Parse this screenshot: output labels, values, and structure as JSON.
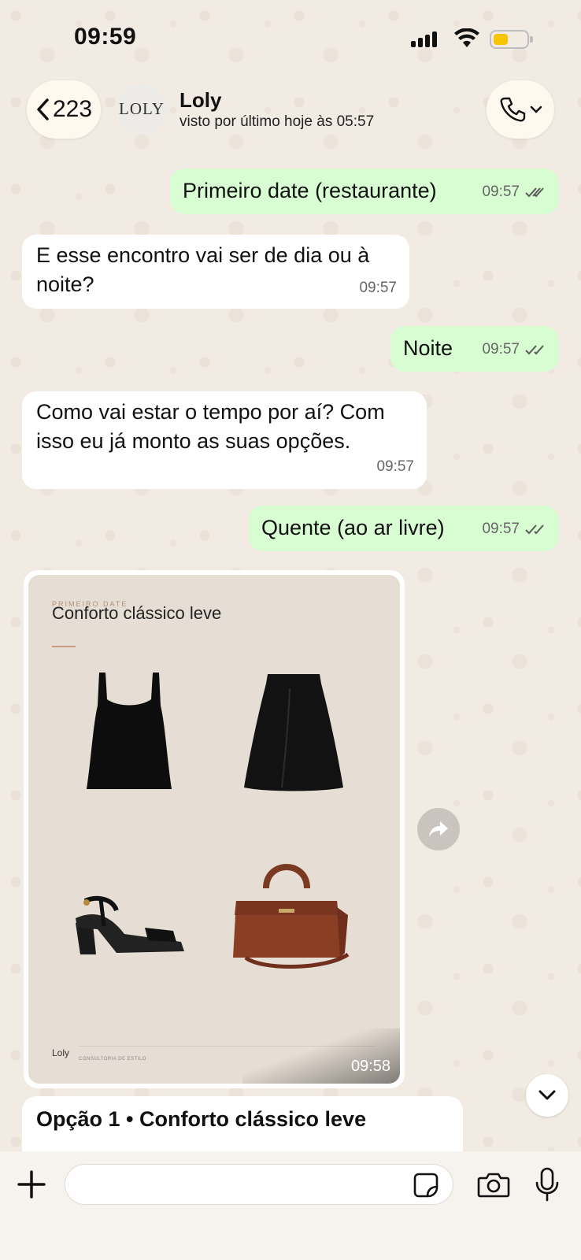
{
  "status_bar": {
    "time": "09:59"
  },
  "header": {
    "back_count": "223",
    "avatar_text": "LOLY",
    "contact_name": "Loly",
    "last_seen": "visto por último hoje às 05:57"
  },
  "messages": [
    {
      "direction": "out",
      "text": "Primeiro date (restaurante)",
      "time": "09:57",
      "status": "read"
    },
    {
      "direction": "in",
      "text": "E esse encontro vai ser de dia ou à noite?",
      "time": "09:57"
    },
    {
      "direction": "out",
      "text": "Noite",
      "time": "09:57",
      "status": "read"
    },
    {
      "direction": "in",
      "text": "Como vai estar o tempo por aí? Com isso eu já monto as suas opções.",
      "time": "09:57"
    },
    {
      "direction": "out",
      "text": "Quente (ao ar livre)",
      "time": "09:57",
      "status": "read"
    }
  ],
  "image_card": {
    "kicker": "PRIMEIRO DATE",
    "title": "Conforto clássico leve",
    "brand": "Loly",
    "brand_sub": "CONSULTORIA DE ESTILO",
    "time": "09:58",
    "items": [
      "black-tank-top",
      "black-midi-skirt",
      "black-block-heel-sandal",
      "brown-leather-handbag"
    ]
  },
  "caption": "Opção 1 • Conforto clássico leve",
  "composer": {
    "placeholder": ""
  },
  "colors": {
    "outgoing_bubble": "#d9fdd3",
    "incoming_bubble": "#ffffff",
    "battery_fill": "#f6c400"
  }
}
